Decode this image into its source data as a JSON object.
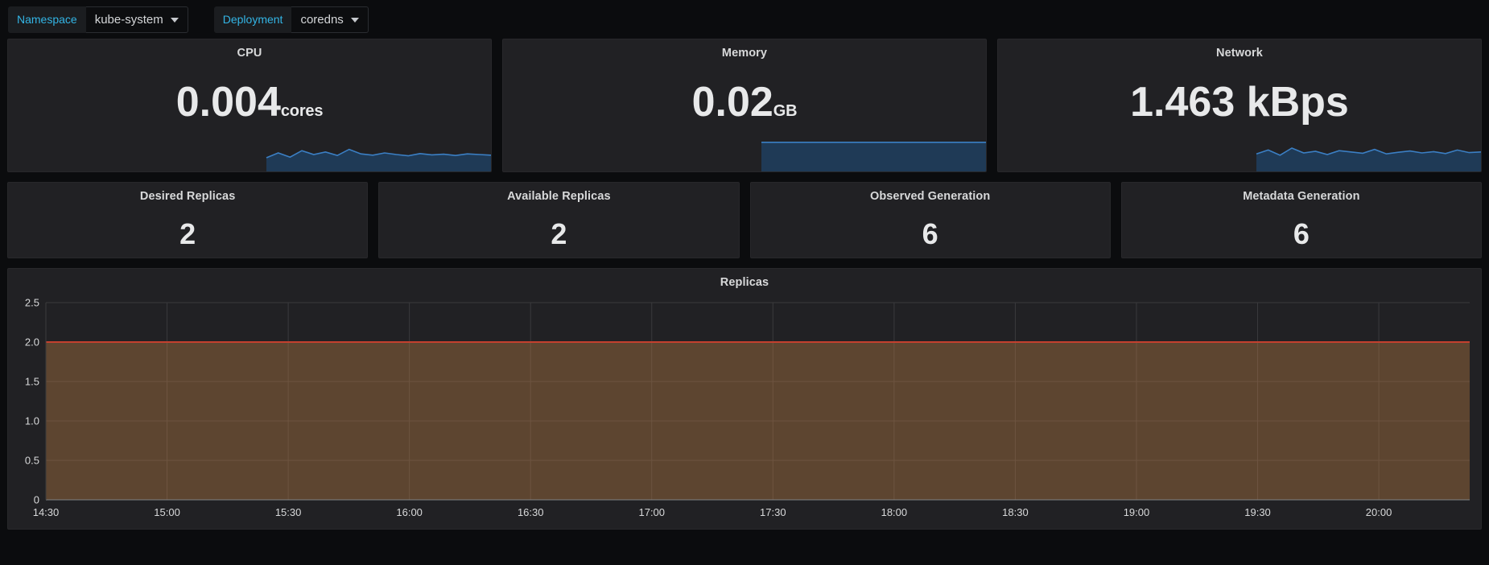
{
  "variables": [
    {
      "label": "Namespace",
      "value": "kube-system",
      "icon": "chevron-down-icon"
    },
    {
      "label": "Deployment",
      "value": "coredns",
      "icon": "chevron-down-icon"
    }
  ],
  "colors": {
    "label_accent": "#33b5e5",
    "panel_bg": "#212124",
    "page_bg": "#0b0c0e",
    "text": "#d8d9da",
    "spark_line": "#3b7fc4",
    "spark_fill": "#1f3a56",
    "series_line": "#c4402e",
    "series_fill": "#5d4530",
    "grid_line": "#3a3a3d"
  },
  "stats_row1": [
    {
      "title": "CPU",
      "value": "0.004",
      "unit": "cores"
    },
    {
      "title": "Memory",
      "value": "0.02",
      "unit": "GB"
    },
    {
      "title": "Network",
      "value": "1.463 kBps",
      "unit": ""
    }
  ],
  "stats_row2": [
    {
      "title": "Desired Replicas",
      "value": "2"
    },
    {
      "title": "Available Replicas",
      "value": "2"
    },
    {
      "title": "Observed Generation",
      "value": "6"
    },
    {
      "title": "Metadata Generation",
      "value": "6"
    }
  ],
  "chart_data": {
    "type": "area",
    "title": "Replicas",
    "xlabel": "",
    "ylabel": "",
    "ylim": [
      0,
      2.5
    ],
    "yticks": [
      "0",
      "0.5",
      "1.0",
      "1.5",
      "2.0",
      "2.5"
    ],
    "ytick_values": [
      0,
      0.5,
      1.0,
      1.5,
      2.0,
      2.5
    ],
    "xticks": [
      "14:30",
      "15:00",
      "15:30",
      "16:00",
      "16:30",
      "17:00",
      "17:30",
      "18:00",
      "18:30",
      "19:00",
      "19:30",
      "20:00"
    ],
    "grid": true,
    "legend": "none",
    "series": [
      {
        "name": "replicas",
        "line_color": "#c4402e",
        "fill_color": "#5d4530",
        "x": [
          "14:30",
          "15:00",
          "15:30",
          "16:00",
          "16:30",
          "17:00",
          "17:30",
          "18:00",
          "18:30",
          "19:00",
          "19:30",
          "20:00",
          "20:20"
        ],
        "values": [
          2,
          2,
          2,
          2,
          2,
          2,
          2,
          2,
          2,
          2,
          2,
          2,
          2
        ]
      }
    ]
  },
  "sparklines": {
    "cpu": {
      "line_color": "#3b7fc4",
      "fill_color": "#1f3a56",
      "points": [
        0.4,
        0.55,
        0.42,
        0.62,
        0.5,
        0.58,
        0.47,
        0.66,
        0.52,
        0.48,
        0.55,
        0.5,
        0.46,
        0.53,
        0.49,
        0.51,
        0.47,
        0.52,
        0.5,
        0.48
      ]
    },
    "memory": {
      "line_color": "#3b7fc4",
      "fill_color": "#1f3a56",
      "points": [
        0.88,
        0.88,
        0.88,
        0.88,
        0.88,
        0.88,
        0.88,
        0.88,
        0.88,
        0.88,
        0.88,
        0.88,
        0.88,
        0.88,
        0.88,
        0.88,
        0.88,
        0.88,
        0.88,
        0.88
      ]
    },
    "network": {
      "line_color": "#3b7fc4",
      "fill_color": "#1f3a56",
      "points": [
        0.52,
        0.64,
        0.48,
        0.7,
        0.55,
        0.6,
        0.5,
        0.62,
        0.58,
        0.54,
        0.66,
        0.52,
        0.57,
        0.61,
        0.55,
        0.59,
        0.53,
        0.64,
        0.56,
        0.58
      ]
    }
  }
}
